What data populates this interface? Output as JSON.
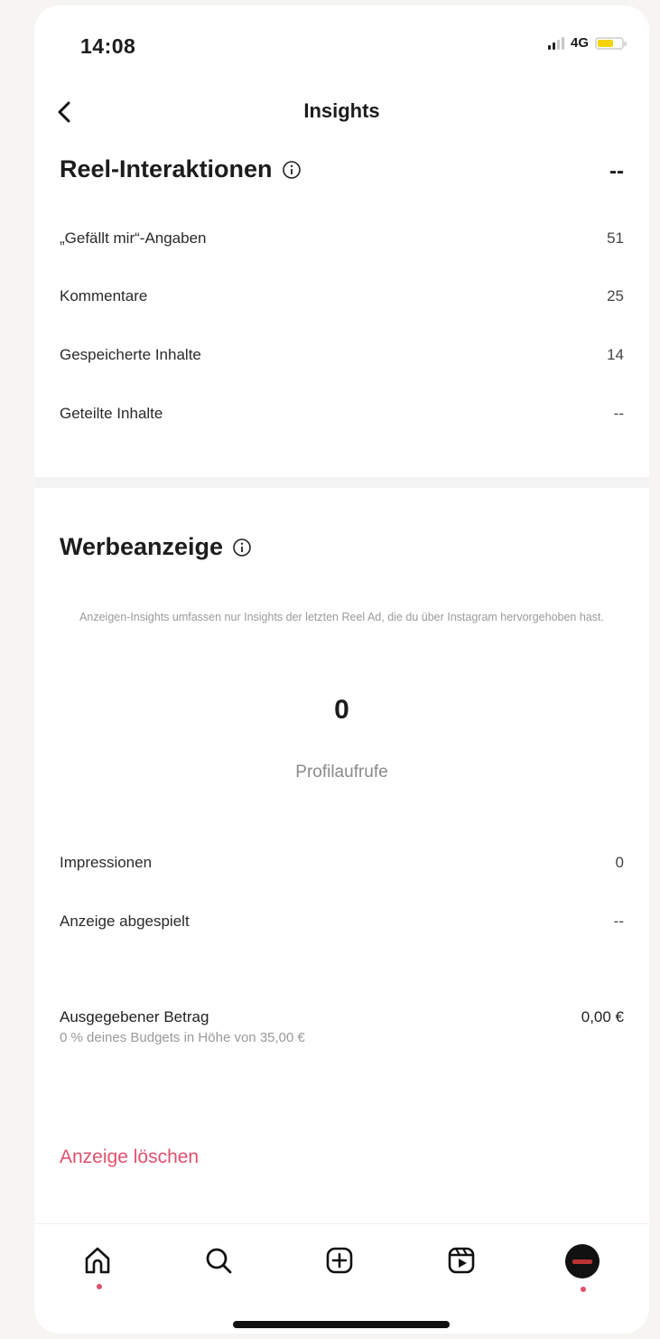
{
  "status_bar": {
    "time": "14:08",
    "network": "4G"
  },
  "nav": {
    "title": "Insights"
  },
  "reel_interactions": {
    "title": "Reel-Interaktionen",
    "total": "--",
    "rows": [
      {
        "label": "„Gefällt mir“-Angaben",
        "value": "51"
      },
      {
        "label": "Kommentare",
        "value": "25"
      },
      {
        "label": "Gespeicherte Inhalte",
        "value": "14"
      },
      {
        "label": "Geteilte Inhalte",
        "value": "--"
      }
    ]
  },
  "ad": {
    "title": "Werbeanzeige",
    "note": "Anzeigen-Insights umfassen nur Insights der letzten Reel Ad, die du über Instagram hervorgehoben hast.",
    "profile_views": {
      "value": "0",
      "label": "Profilaufrufe"
    },
    "rows": [
      {
        "label": "Impressionen",
        "value": "0"
      },
      {
        "label": "Anzeige abgespielt",
        "value": "--"
      }
    ],
    "spent": {
      "label": "Ausgegebener Betrag",
      "sub": "0 % deines Budgets in Höhe von 35,00 €",
      "amount": "0,00 €"
    },
    "delete_label": "Anzeige löschen"
  },
  "tabbar": {
    "items": [
      "home-icon",
      "search-icon",
      "create-icon",
      "reels-icon",
      "profile-avatar"
    ]
  }
}
